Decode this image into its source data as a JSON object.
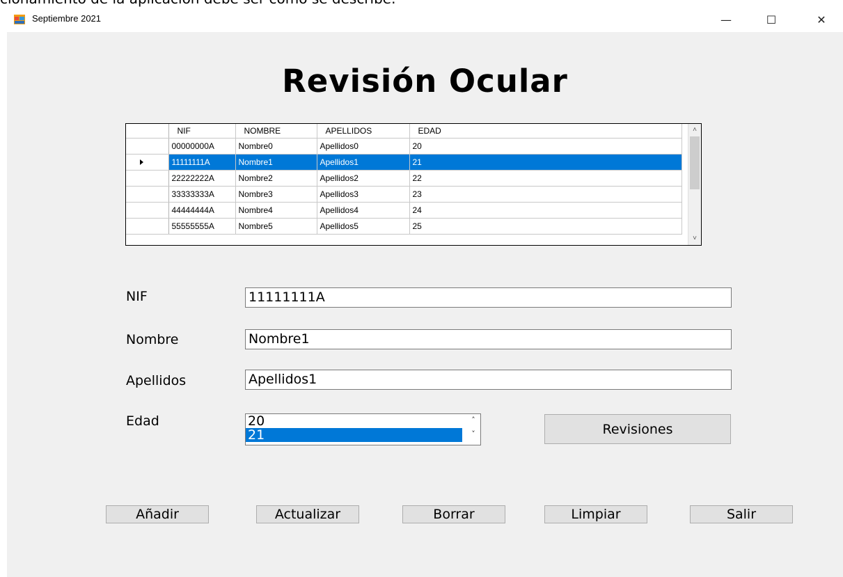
{
  "background_caption": "cionamiento de la aplicación debe ser como se describe.",
  "window": {
    "title": "Septiembre 2021",
    "controls": {
      "minimize": "—",
      "maximize": "☐",
      "close": "✕"
    }
  },
  "heading": "Revisión Ocular",
  "grid": {
    "columns": [
      "NIF",
      "NOMBRE",
      "APELLIDOS",
      "EDAD"
    ],
    "rows": [
      [
        "00000000A",
        "Nombre0",
        "Apellidos0",
        "20"
      ],
      [
        "11111111A",
        "Nombre1",
        "Apellidos1",
        "21"
      ],
      [
        "22222222A",
        "Nombre2",
        "Apellidos2",
        "22"
      ],
      [
        "33333333A",
        "Nombre3",
        "Apellidos3",
        "23"
      ],
      [
        "44444444A",
        "Nombre4",
        "Apellidos4",
        "24"
      ],
      [
        "55555555A",
        "Nombre5",
        "Apellidos5",
        "25"
      ]
    ],
    "selected_row": 1,
    "selection_color": "#0078d7"
  },
  "form": {
    "nif": {
      "label": "NIF",
      "value": "11111111A"
    },
    "nombre": {
      "label": "Nombre",
      "value": "Nombre1"
    },
    "apellidos": {
      "label": "Apellidos",
      "value": "Apellidos1"
    },
    "edad": {
      "label": "Edad",
      "options": [
        "20",
        "21"
      ],
      "selected": "21"
    }
  },
  "buttons": {
    "revisiones": "Revisiones",
    "anadir": "Añadir",
    "actualizar": "Actualizar",
    "borrar": "Borrar",
    "limpiar": "Limpiar",
    "salir": "Salir"
  }
}
